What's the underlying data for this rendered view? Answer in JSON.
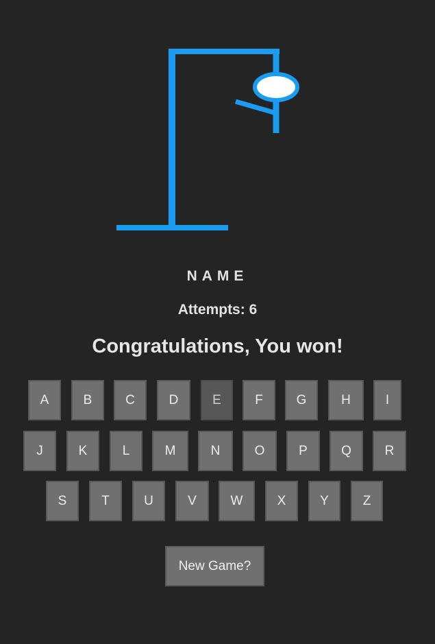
{
  "game": {
    "word": "NAME",
    "attempts_text": "Attempts: 6",
    "message": "Congratulations, You won!",
    "new_game_label": "New Game?"
  },
  "keyboard": {
    "row1": [
      "A",
      "B",
      "C",
      "D",
      "E",
      "F",
      "G",
      "H",
      "I"
    ],
    "row2": [
      "J",
      "K",
      "L",
      "M",
      "N",
      "O",
      "P",
      "Q",
      "R"
    ],
    "row3": [
      "S",
      "T",
      "U",
      "V",
      "W",
      "X",
      "Y",
      "Z"
    ],
    "used_keys": [
      "E"
    ]
  },
  "colors": {
    "background": "#242424",
    "gallows": "#1a9cf0",
    "key": "#707070",
    "key_used": "#575757",
    "text": "#e2e2e2"
  }
}
